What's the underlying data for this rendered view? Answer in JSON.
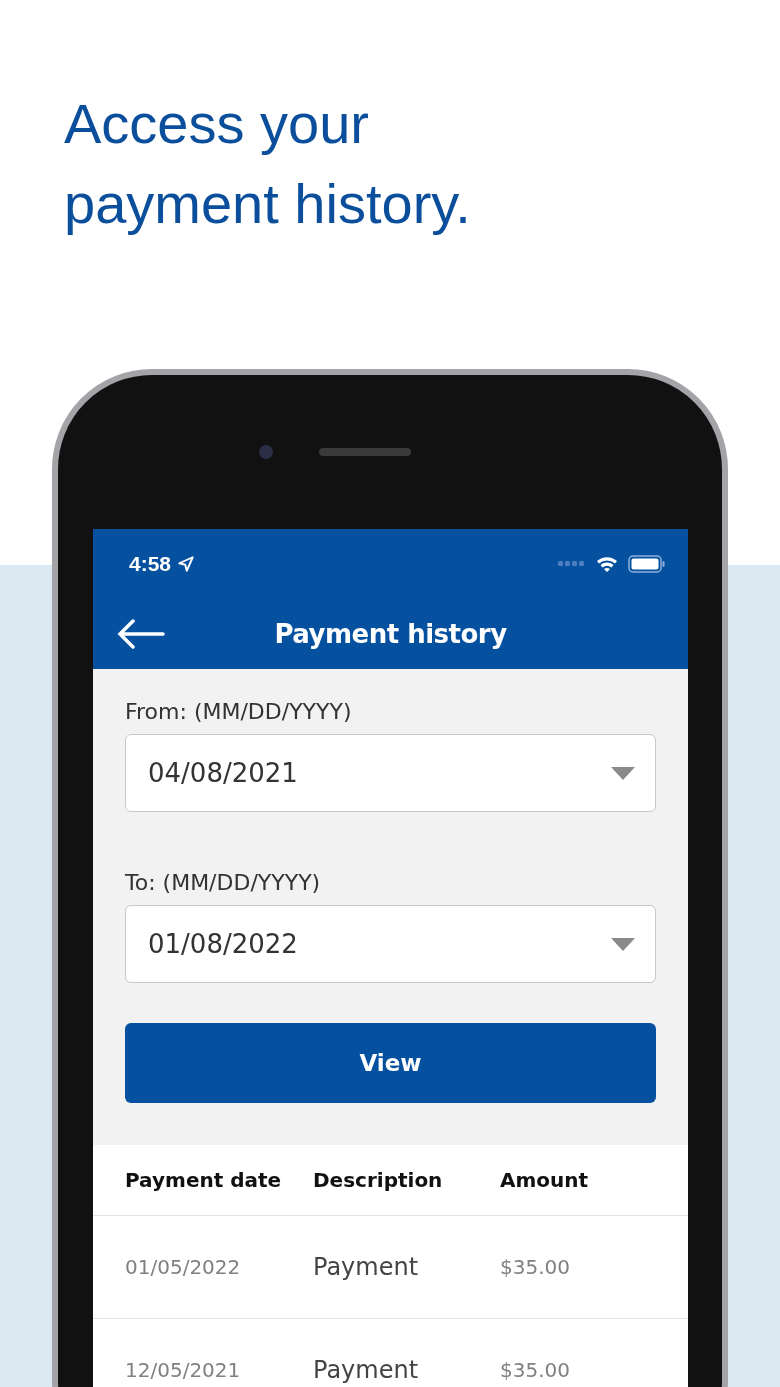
{
  "headline": "Access your payment history.",
  "status_bar": {
    "time": "4:58"
  },
  "header": {
    "title": "Payment history"
  },
  "fields": [
    {
      "label": "From: (MM/DD/YYYY)",
      "value": "04/08/2021"
    },
    {
      "label": "To: (MM/DD/YYYY)",
      "value": "01/08/2022"
    }
  ],
  "button": "View",
  "table": {
    "columns": [
      "Payment date",
      "Description",
      "Amount"
    ],
    "rows": [
      [
        "01/05/2022",
        "Payment",
        "$35.00"
      ],
      [
        "12/05/2021",
        "Payment",
        "$35.00"
      ]
    ]
  }
}
